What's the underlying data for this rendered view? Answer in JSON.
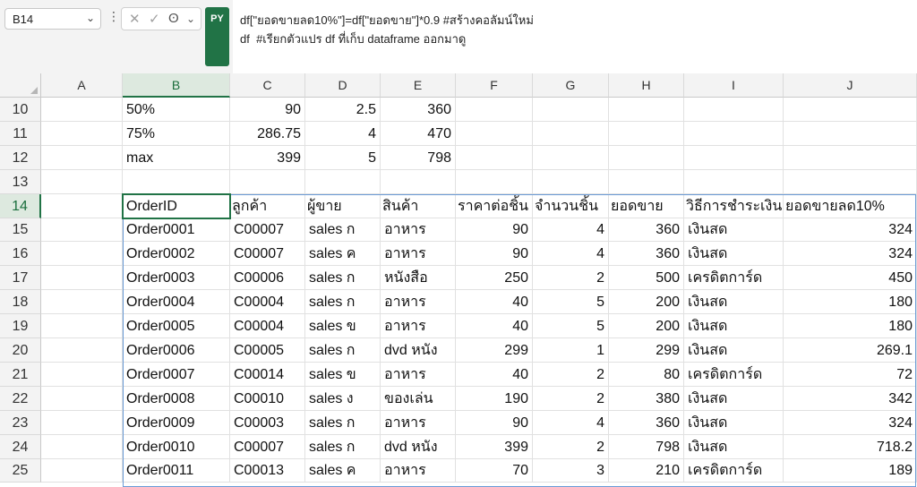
{
  "name_box": {
    "value": "B14"
  },
  "formula_bar": {
    "py_badge": "PY",
    "line1": "df[\"ยอดขายลด10%\"]=df[\"ยอดขาย\"]*0.9 #สร้างคอลัมน์ใหม่",
    "line2": "df  #เรียกตัวแปร df ที่เก็บ dataframe ออกมาดู"
  },
  "selected_cell": "B14",
  "columns": [
    "A",
    "B",
    "C",
    "D",
    "E",
    "F",
    "G",
    "H",
    "I",
    "J"
  ],
  "rows": [
    {
      "num": "10",
      "cells": [
        "",
        "50%",
        "90",
        "2.5",
        "360",
        "",
        "",
        "",
        "",
        ""
      ]
    },
    {
      "num": "11",
      "cells": [
        "",
        "75%",
        "286.75",
        "4",
        "470",
        "",
        "",
        "",
        "",
        ""
      ]
    },
    {
      "num": "12",
      "cells": [
        "",
        "max",
        "399",
        "5",
        "798",
        "",
        "",
        "",
        "",
        ""
      ]
    },
    {
      "num": "13",
      "cells": [
        "",
        "",
        "",
        "",
        "",
        "",
        "",
        "",
        "",
        ""
      ]
    },
    {
      "num": "14",
      "cells": [
        "",
        "OrderID",
        "ลูกค้า",
        "ผู้ขาย",
        "สินค้า",
        "ราคาต่อชิ้น",
        "จำนวนชิ้น",
        "ยอดขาย",
        "วิธีการชำระเงิน",
        "ยอดขายลด10%"
      ]
    },
    {
      "num": "15",
      "cells": [
        "",
        "Order0001",
        "C00007",
        "sales ก",
        "อาหาร",
        "90",
        "4",
        "360",
        "เงินสด",
        "324"
      ]
    },
    {
      "num": "16",
      "cells": [
        "",
        "Order0002",
        "C00007",
        "sales ค",
        "อาหาร",
        "90",
        "4",
        "360",
        "เงินสด",
        "324"
      ]
    },
    {
      "num": "17",
      "cells": [
        "",
        "Order0003",
        "C00006",
        "sales ก",
        "หนังสือ",
        "250",
        "2",
        "500",
        "เครดิตการ์ด",
        "450"
      ]
    },
    {
      "num": "18",
      "cells": [
        "",
        "Order0004",
        "C00004",
        "sales ก",
        "อาหาร",
        "40",
        "5",
        "200",
        "เงินสด",
        "180"
      ]
    },
    {
      "num": "19",
      "cells": [
        "",
        "Order0005",
        "C00004",
        "sales ข",
        "อาหาร",
        "40",
        "5",
        "200",
        "เงินสด",
        "180"
      ]
    },
    {
      "num": "20",
      "cells": [
        "",
        "Order0006",
        "C00005",
        "sales ก",
        "dvd หนัง",
        "299",
        "1",
        "299",
        "เงินสด",
        "269.1"
      ]
    },
    {
      "num": "21",
      "cells": [
        "",
        "Order0007",
        "C00014",
        "sales ข",
        "อาหาร",
        "40",
        "2",
        "80",
        "เครดิตการ์ด",
        "72"
      ]
    },
    {
      "num": "22",
      "cells": [
        "",
        "Order0008",
        "C00010",
        "sales ง",
        "ของเล่น",
        "190",
        "2",
        "380",
        "เงินสด",
        "342"
      ]
    },
    {
      "num": "23",
      "cells": [
        "",
        "Order0009",
        "C00003",
        "sales ก",
        "อาหาร",
        "90",
        "4",
        "360",
        "เงินสด",
        "324"
      ]
    },
    {
      "num": "24",
      "cells": [
        "",
        "Order0010",
        "C00007",
        "sales ก",
        "dvd หนัง",
        "399",
        "2",
        "798",
        "เงินสด",
        "718.2"
      ]
    },
    {
      "num": "25",
      "cells": [
        "",
        "Order0011",
        "C00013",
        "sales ค",
        "อาหาร",
        "70",
        "3",
        "210",
        "เครดิตการ์ด",
        "189"
      ]
    }
  ]
}
